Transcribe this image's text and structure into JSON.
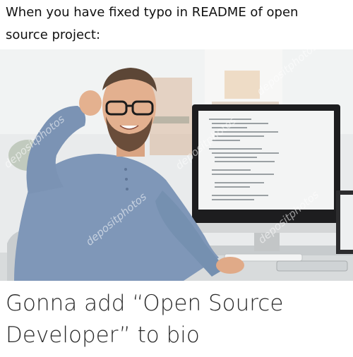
{
  "meme": {
    "top_caption": "When you have fixed typo in README of open\nsource project:",
    "bottom_caption": "Gonna add “Open Source Developer” to bio",
    "watermark_text": "depositphotos"
  },
  "colors": {
    "shirt": "#7f97b8",
    "wall": "#eceeef",
    "monitor_screen": "#f3f4f4",
    "desk": "#d7dadb"
  }
}
